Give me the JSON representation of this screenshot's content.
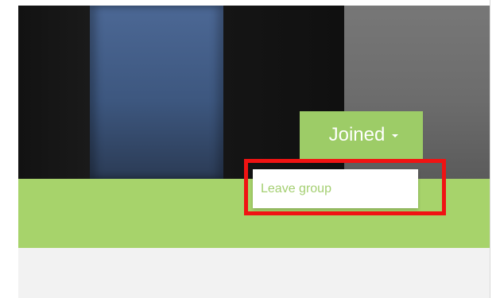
{
  "group_header": {
    "membership_button": {
      "label": "Joined",
      "icon": "caret-down-icon"
    },
    "dropdown": {
      "items": [
        {
          "label": "Leave group"
        }
      ]
    }
  },
  "colors": {
    "green": "#a7d36b",
    "button_green": "#9dcc67",
    "link_green": "#a4cf71",
    "highlight_red": "#f01313",
    "page_gray": "#f2f2f2"
  }
}
